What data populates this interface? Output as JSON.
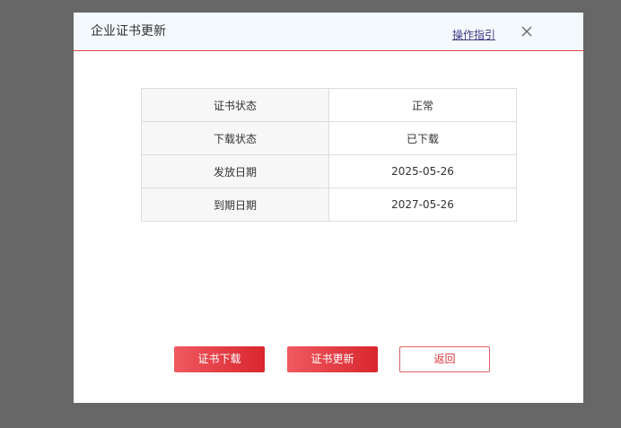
{
  "dialog": {
    "title": "企业证书更新",
    "guide_link": "操作指引"
  },
  "cert_info": {
    "rows": [
      {
        "label": "证书状态",
        "value": "正常"
      },
      {
        "label": "下载状态",
        "value": "已下载"
      },
      {
        "label": "发放日期",
        "value": "2025-05-26"
      },
      {
        "label": "到期日期",
        "value": "2027-05-26"
      }
    ]
  },
  "actions": {
    "download_label": "证书下载",
    "update_label": "证书更新",
    "back_label": "返回"
  },
  "icons": {
    "close": "close-icon"
  },
  "colors": {
    "accent": "#d9262e",
    "header_bg": "#f3f9fd",
    "overlay": "#676767"
  }
}
